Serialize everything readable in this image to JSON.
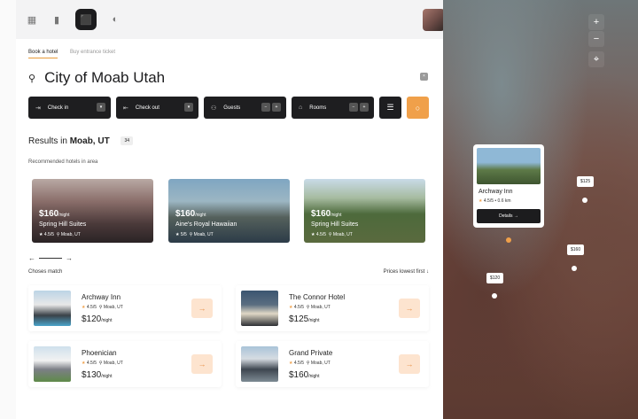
{
  "tabs": [
    "Book a hotel",
    "Buy entrance ticket"
  ],
  "search": {
    "query": "City of Moab Utah"
  },
  "filters": {
    "checkin": "Check in",
    "checkout": "Check out",
    "guests": "Guests",
    "rooms": "Rooms"
  },
  "results": {
    "prefix": "Results in ",
    "place": "Moab, UT",
    "count": "34"
  },
  "recommended_label": "Recommended hotels in area",
  "featured": [
    {
      "price": "$160",
      "unit": "/night",
      "name": "Spring Hill Suites",
      "rating": "4.5/5",
      "location": "Moab, UT"
    },
    {
      "price": "$160",
      "unit": "/night",
      "name": "Aine's Royal Hawaiian",
      "rating": "5/5",
      "location": "Moab, UT"
    },
    {
      "price": "$160",
      "unit": "/night",
      "name": "Spring Hill Suites",
      "rating": "4.5/5",
      "location": "Moab, UT"
    }
  ],
  "chose_label": "Choses match",
  "sort_label": "Prices lowest first",
  "hotels": [
    {
      "name": "Archway Inn",
      "rating": "4.5/5",
      "location": "Moab, UT",
      "price": "$120",
      "unit": "/night"
    },
    {
      "name": "The Connor Hotel",
      "rating": "4.5/5",
      "location": "Moab, UT",
      "price": "$125",
      "unit": "/night"
    },
    {
      "name": "Phoenician",
      "rating": "4.5/5",
      "location": "Moab, UT",
      "price": "$130",
      "unit": "/night"
    },
    {
      "name": "Grand Private",
      "rating": "4.5/5",
      "location": "Moab, UT",
      "price": "$160",
      "unit": "/night"
    }
  ],
  "map": {
    "popup": {
      "name": "Archway Inn",
      "meta": "4.5/5 • 0.6 km",
      "button": "Details"
    },
    "tags": [
      "$125",
      "$160",
      "$120"
    ]
  },
  "colors": {
    "accent": "#f0a04a",
    "dark": "#1c1c1e"
  }
}
